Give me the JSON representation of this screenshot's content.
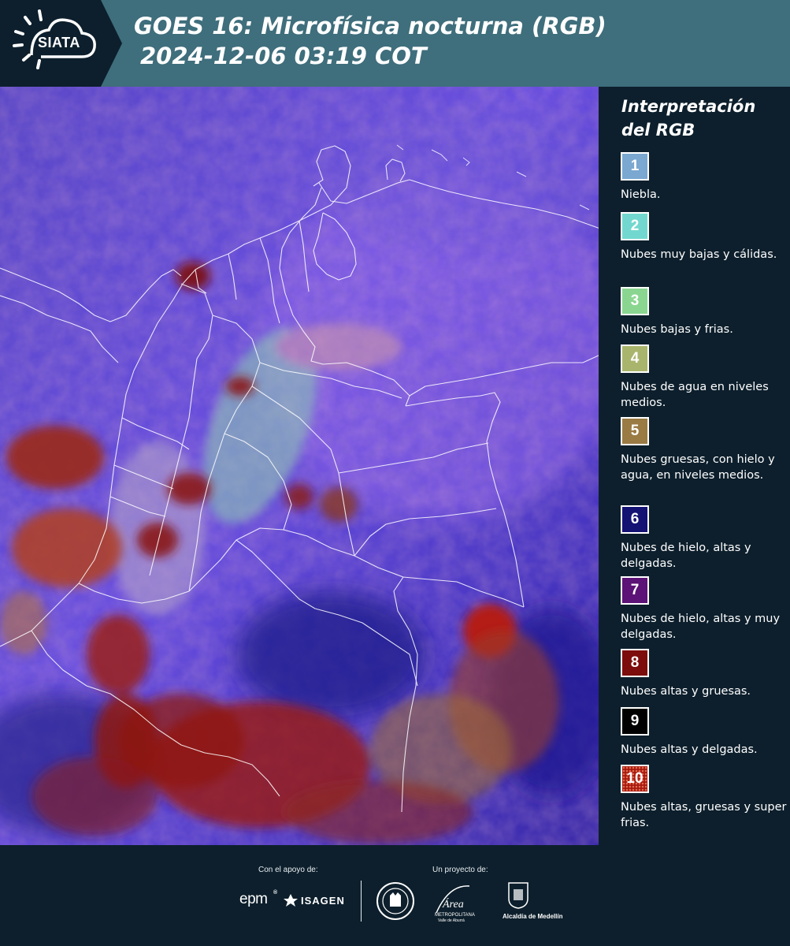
{
  "header": {
    "logo_text": "SIATA",
    "title_line1": "GOES 16: Microfísica nocturna (RGB)",
    "title_line2": "2024-12-06 03:19 COT",
    "background": "#3f6e7c"
  },
  "legend": {
    "title_line1": "Interpretación",
    "title_line2": "del RGB",
    "items": [
      {
        "number": "1",
        "label": "Niebla.",
        "color": "#7aa8d0"
      },
      {
        "number": "2",
        "label": "Nubes muy bajas y cálidas.",
        "color": "#72d8cf"
      },
      {
        "number": "3",
        "label": "Nubes bajas y frias.",
        "color": "#8ad690"
      },
      {
        "number": "4",
        "label": "Nubes de agua en niveles medios.",
        "color": "#a9b56c"
      },
      {
        "number": "5",
        "label": "Nubes gruesas, con hielo y agua, en niveles medios.",
        "color": "#9a7b44"
      },
      {
        "number": "6",
        "label": "Nubes de hielo, altas y delgadas.",
        "color": "#141273"
      },
      {
        "number": "7",
        "label": "Nubes de hielo, altas y muy delgadas.",
        "color": "#5c1276"
      },
      {
        "number": "8",
        "label": "Nubes altas y gruesas.",
        "color": "#7d0c0c"
      },
      {
        "number": "9",
        "label": "Nubes altas y delgadas.",
        "color": "#000000"
      },
      {
        "number": "10",
        "label": "Nubes altas, gruesas y super frias.",
        "color": "#a8180e"
      }
    ]
  },
  "footer": {
    "support_caption": "Con el apoyo de:",
    "project_caption": "Un proyecto de:",
    "sponsor_epm": "epm",
    "sponsor_isagen": "ISAGEN",
    "area_name": "Área",
    "area_sub1": "METROPOLITANA",
    "area_sub2": "Valle de Aburrá",
    "alcaldia": "Alcaldía de Medellín"
  }
}
